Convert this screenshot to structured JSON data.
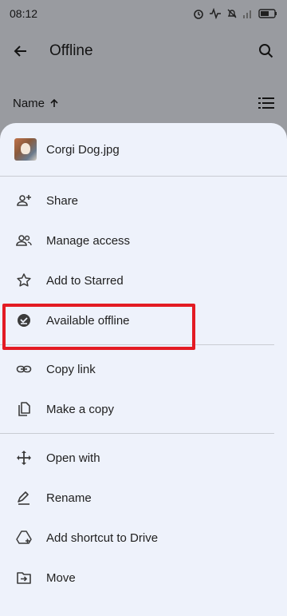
{
  "status_bar": {
    "time": "08:12"
  },
  "app_bar": {
    "title": "Offline"
  },
  "sort": {
    "label": "Name"
  },
  "sheet": {
    "file_name": "Corgi Dog.jpg",
    "groups": [
      [
        {
          "label": "Share",
          "icon": "person-add-icon"
        },
        {
          "label": "Manage access",
          "icon": "people-icon"
        },
        {
          "label": "Add to Starred",
          "icon": "star-icon"
        },
        {
          "label": "Available offline",
          "icon": "offline-check-icon"
        }
      ],
      [
        {
          "label": "Copy link",
          "icon": "link-icon"
        },
        {
          "label": "Make a copy",
          "icon": "copy-icon"
        }
      ],
      [
        {
          "label": "Open with",
          "icon": "move-arrows-icon"
        },
        {
          "label": "Rename",
          "icon": "pencil-icon"
        },
        {
          "label": "Add shortcut to Drive",
          "icon": "drive-shortcut-icon"
        },
        {
          "label": "Move",
          "icon": "folder-move-icon"
        }
      ]
    ]
  },
  "colors": {
    "highlight": "#e31b23",
    "sheet_bg": "#eef2fb"
  }
}
